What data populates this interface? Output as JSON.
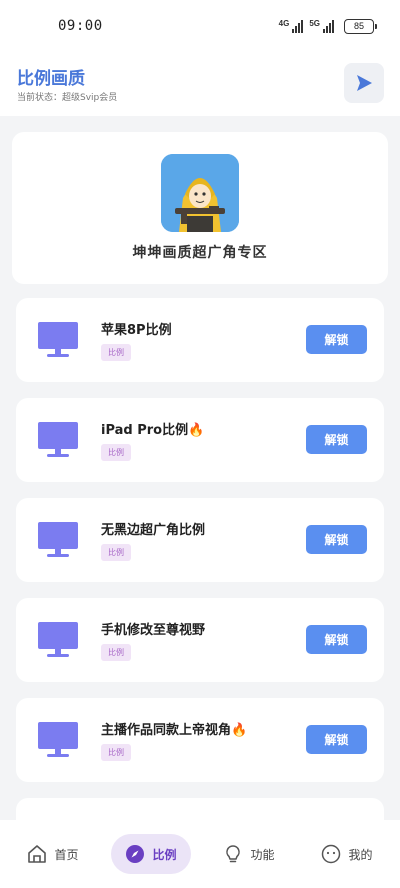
{
  "status_bar": {
    "time": "09:00",
    "signal_1_label": "4G",
    "signal_2_label": "5G",
    "battery": "85"
  },
  "header": {
    "title": "比例画质",
    "status": "当前状态：超级Svip会员",
    "play_icon": "play-icon"
  },
  "hero": {
    "title": "坤坤画质超广角专区",
    "avatar_icon": "character-avatar"
  },
  "items": [
    {
      "title": "苹果8P比例",
      "tag": "比例",
      "button": "解锁"
    },
    {
      "title": "iPad Pro比例🔥",
      "tag": "比例",
      "button": "解锁"
    },
    {
      "title": "无黑边超广角比例",
      "tag": "比例",
      "button": "解锁"
    },
    {
      "title": "手机修改至尊视野",
      "tag": "比例",
      "button": "解锁"
    },
    {
      "title": "主播作品同款上帝视角🔥",
      "tag": "比例",
      "button": "解锁"
    }
  ],
  "bottom_nav": [
    {
      "label": "首页",
      "icon": "home-icon",
      "active": false
    },
    {
      "label": "比例",
      "icon": "compass-icon",
      "active": true
    },
    {
      "label": "功能",
      "icon": "lightbulb-icon",
      "active": false
    },
    {
      "label": "我的",
      "icon": "smiley-icon",
      "active": false
    }
  ],
  "colors": {
    "accent": "#5a8ff0",
    "title": "#4a78d9",
    "monitor": "#7b7cf0",
    "nav_active_bg": "#ebe4f7",
    "nav_active_fg": "#6a3fc2"
  }
}
